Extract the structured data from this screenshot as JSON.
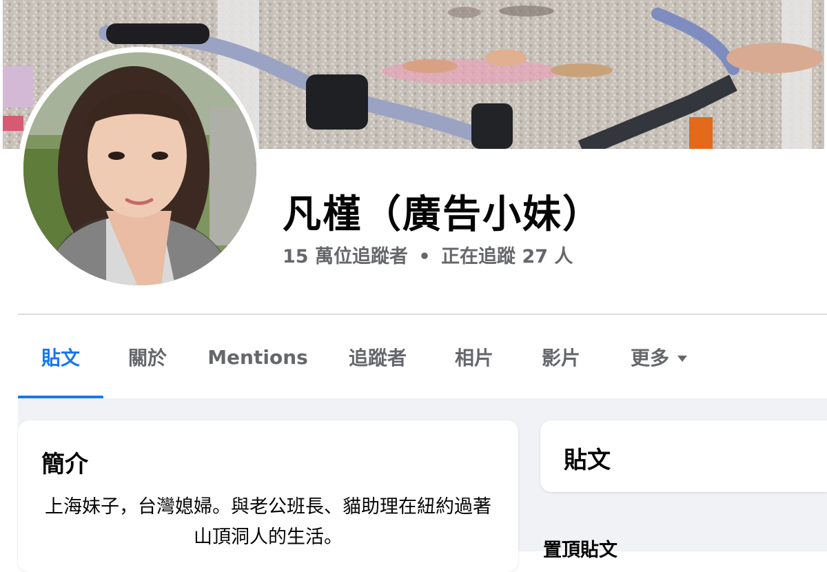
{
  "profile": {
    "name": "凡槿（廣告小妹）",
    "followers": "15 萬位追蹤者",
    "separator": "•",
    "following": "正在追蹤 27 人"
  },
  "tabs": [
    {
      "label": "貼文",
      "active": true
    },
    {
      "label": "關於",
      "active": false
    },
    {
      "label": "Mentions",
      "active": false
    },
    {
      "label": "追蹤者",
      "active": false
    },
    {
      "label": "相片",
      "active": false
    },
    {
      "label": "影片",
      "active": false
    },
    {
      "label": "更多",
      "active": false
    }
  ],
  "intro": {
    "title": "簡介",
    "bio": "上海妹子，台灣媳婦。與老公班長、貓助理在紐約過著山頂洞人的生活。"
  },
  "posts": {
    "title": "貼文",
    "pinned_label": "置頂貼文"
  },
  "colors": {
    "accent": "#1877f2",
    "text_primary": "#050505",
    "text_secondary": "#65676b",
    "page_bg": "#f0f2f5"
  },
  "icons": {
    "more_caret": "caret-down-icon"
  }
}
